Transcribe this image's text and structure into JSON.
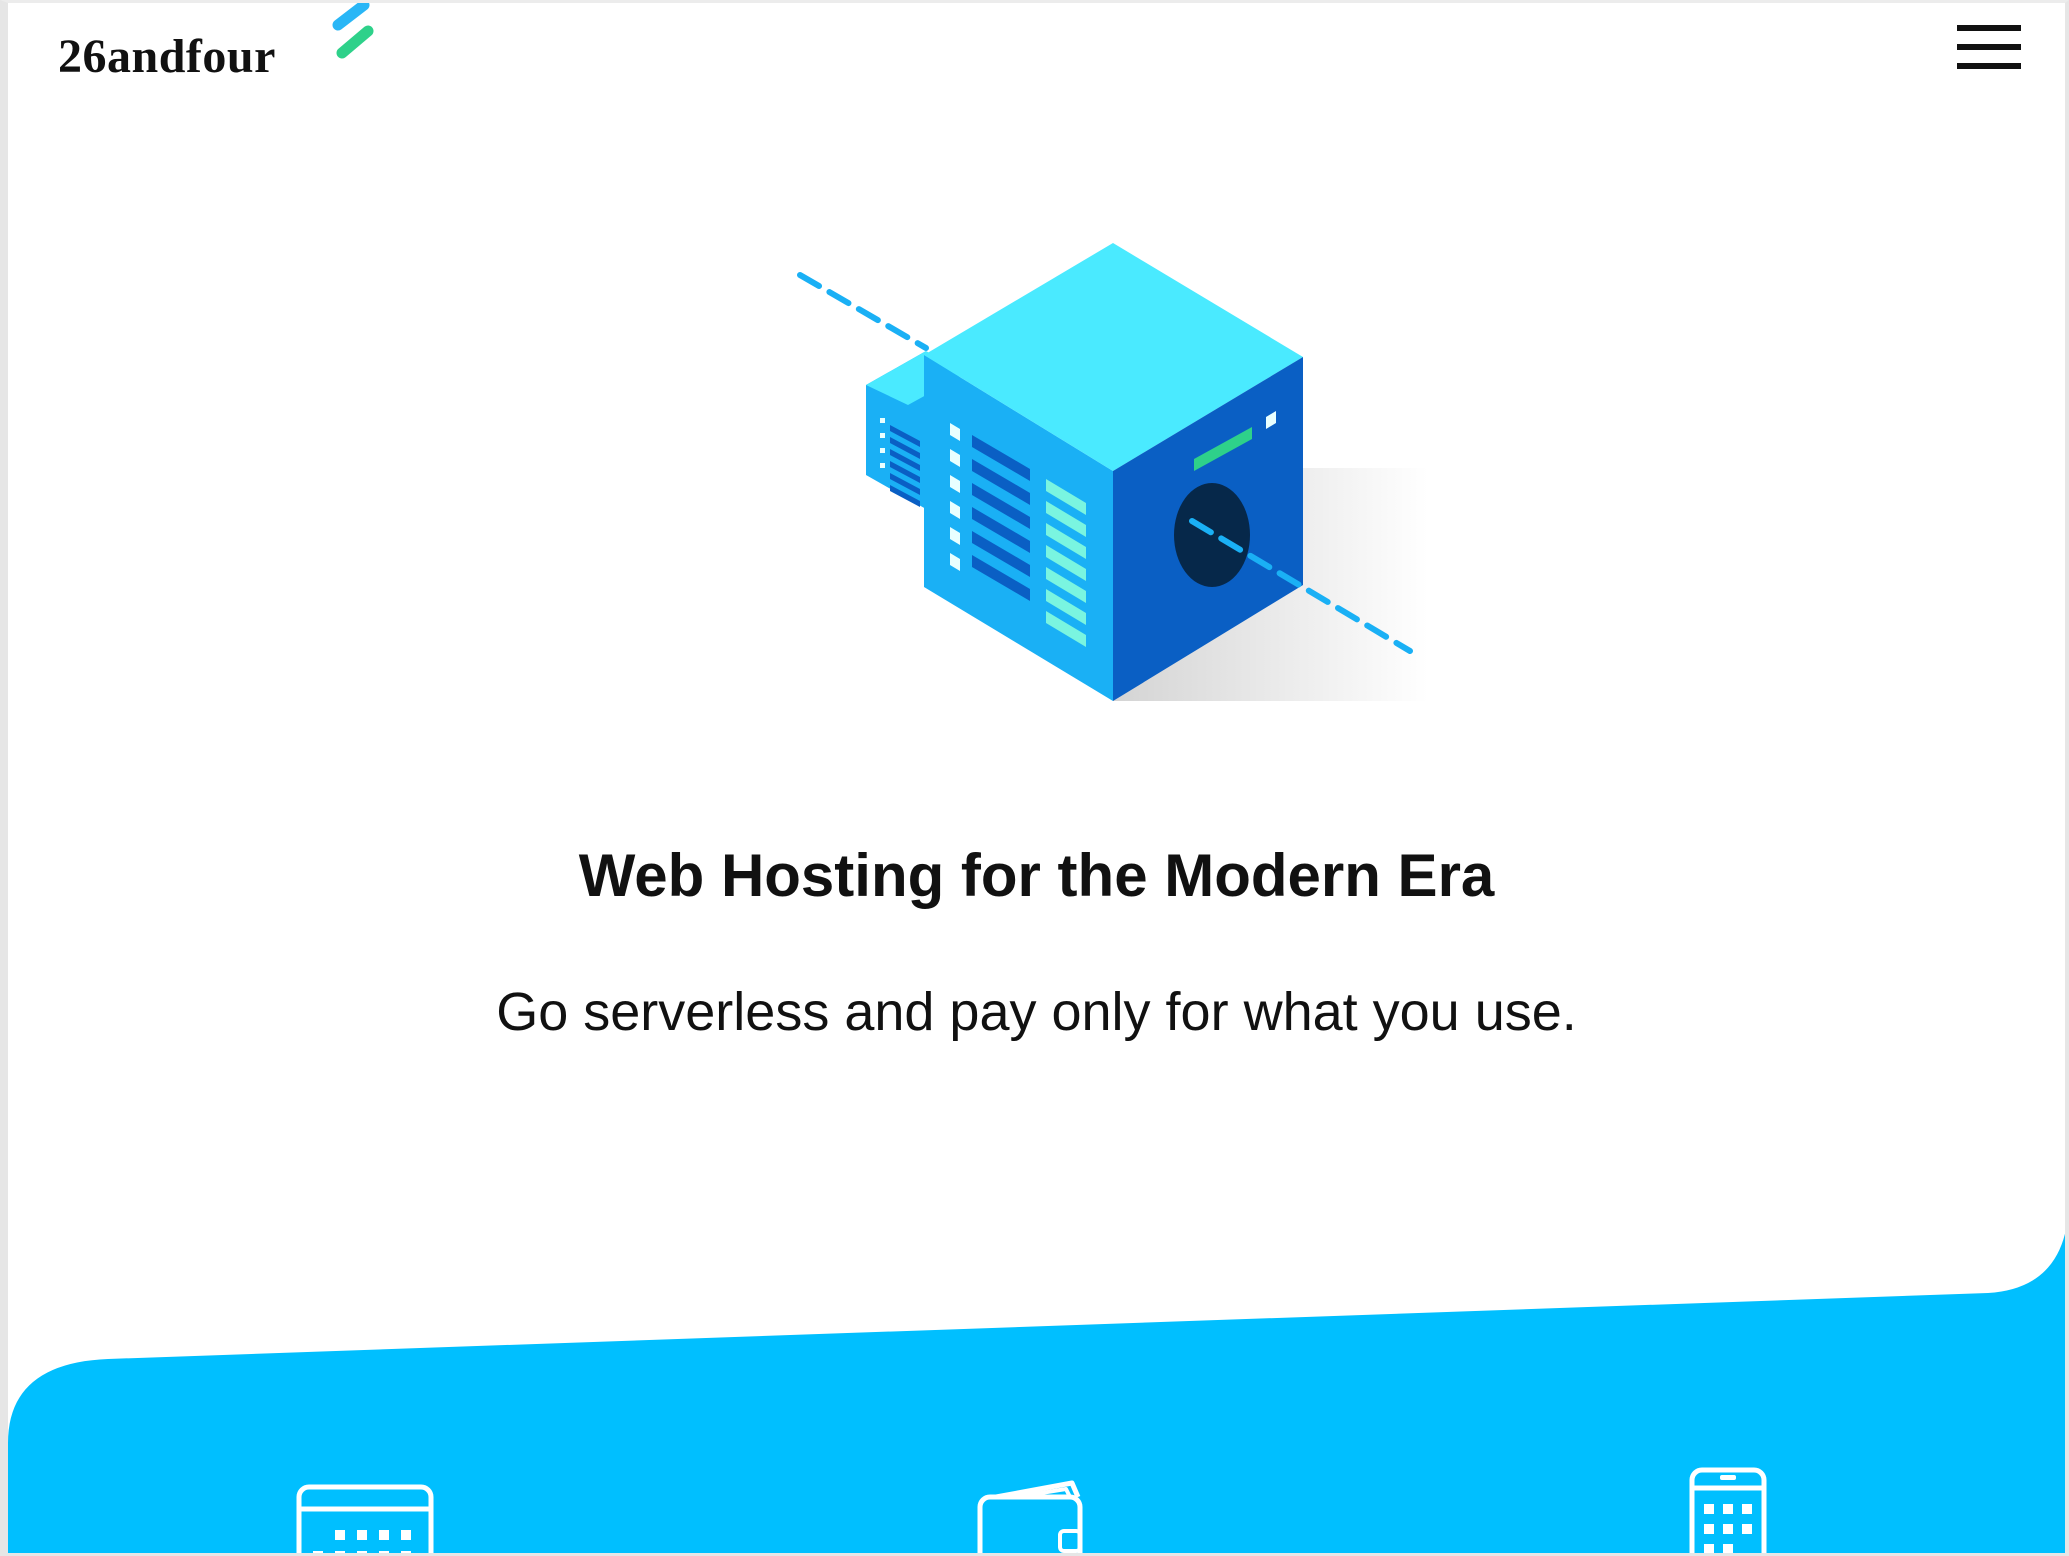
{
  "header": {
    "brand": "26andfour",
    "logo_mark_icon": "slash-stripes-logo-icon",
    "menu_icon": "hamburger-menu-icon"
  },
  "hero": {
    "illustration_icon": "isometric-server-cube-illustration",
    "title": "Web Hosting for the Modern Era",
    "subtitle": "Go serverless and pay only for what you use."
  },
  "features": {
    "background_color": "#00bfff",
    "icons": [
      "calendar-icon",
      "wallet-icon",
      "mobile-phone-icon"
    ]
  },
  "colors": {
    "accent": "#00bfff",
    "logo_blue": "#29b6f6",
    "logo_green": "#2ed18a",
    "cube_top": "#4aeaff",
    "cube_left": "#1ab0f5",
    "cube_right": "#0a5fc4"
  }
}
